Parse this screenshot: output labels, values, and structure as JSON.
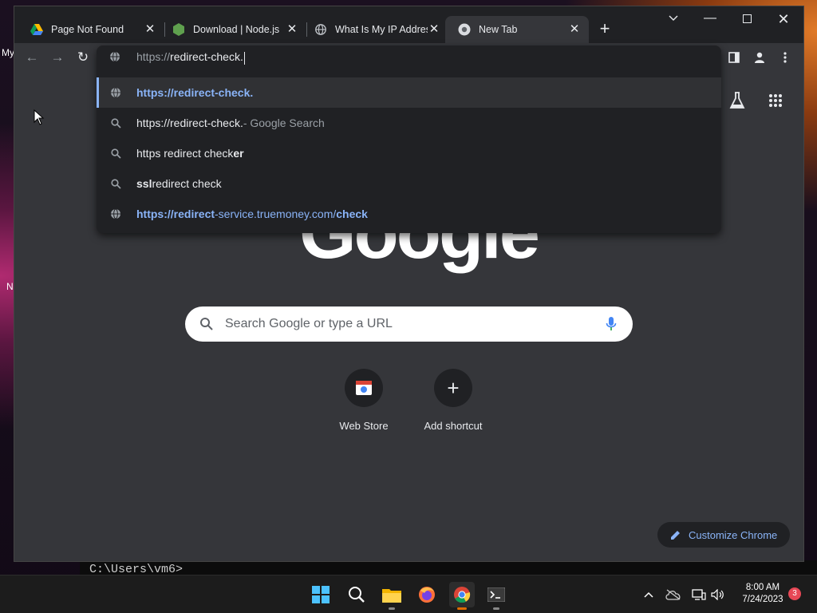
{
  "desktop": {
    "left_labels": [
      "My",
      "N"
    ],
    "terminal_prompt": "C:\\Users\\vm6>"
  },
  "tabs": [
    {
      "title": "Page Not Found",
      "icon": "google-drive-icon",
      "active": false
    },
    {
      "title": "Download | Node.js",
      "icon": "nodejs-icon",
      "active": false
    },
    {
      "title": "What Is My IP Address",
      "icon": "globe-icon",
      "active": false
    },
    {
      "title": "New Tab",
      "icon": "chrome-icon",
      "active": true
    }
  ],
  "omnibox": {
    "input_prefix": "https://",
    "input_typed": "redirect-check.",
    "suggestions": [
      {
        "type": "url",
        "icon": "globe-icon",
        "bold": "https://redirect-check.",
        "rest": "",
        "suffix": "",
        "selected": true
      },
      {
        "type": "search",
        "icon": "search-icon",
        "bold": "",
        "rest": "https://redirect-check.",
        "suffix": " - Google Search",
        "selected": false
      },
      {
        "type": "search",
        "icon": "search-icon",
        "pre": "https redirect check",
        "bold": "er",
        "selected": false
      },
      {
        "type": "search",
        "icon": "search-icon",
        "bold": "ssl",
        "rest": " redirect check",
        "selected": false
      },
      {
        "type": "url",
        "icon": "globe-icon",
        "bold1": "https://redirect",
        "mid": "-service.truemoney.com/",
        "bold2": "check",
        "selected": false
      }
    ]
  },
  "ntp": {
    "logo": "Google",
    "search_placeholder": "Search Google or type a URL",
    "shortcuts": [
      {
        "label": "Web Store",
        "icon": "web-store-icon"
      },
      {
        "label": "Add shortcut",
        "icon": "plus-icon"
      }
    ],
    "customize_label": "Customize Chrome"
  },
  "taskbar": {
    "time": "8:00 AM",
    "date": "7/24/2023",
    "notification_count": "3"
  },
  "colors": {
    "accent": "#8ab4f8",
    "toolbar": "#35363a",
    "frame": "#202124",
    "badge": "#e74856"
  }
}
